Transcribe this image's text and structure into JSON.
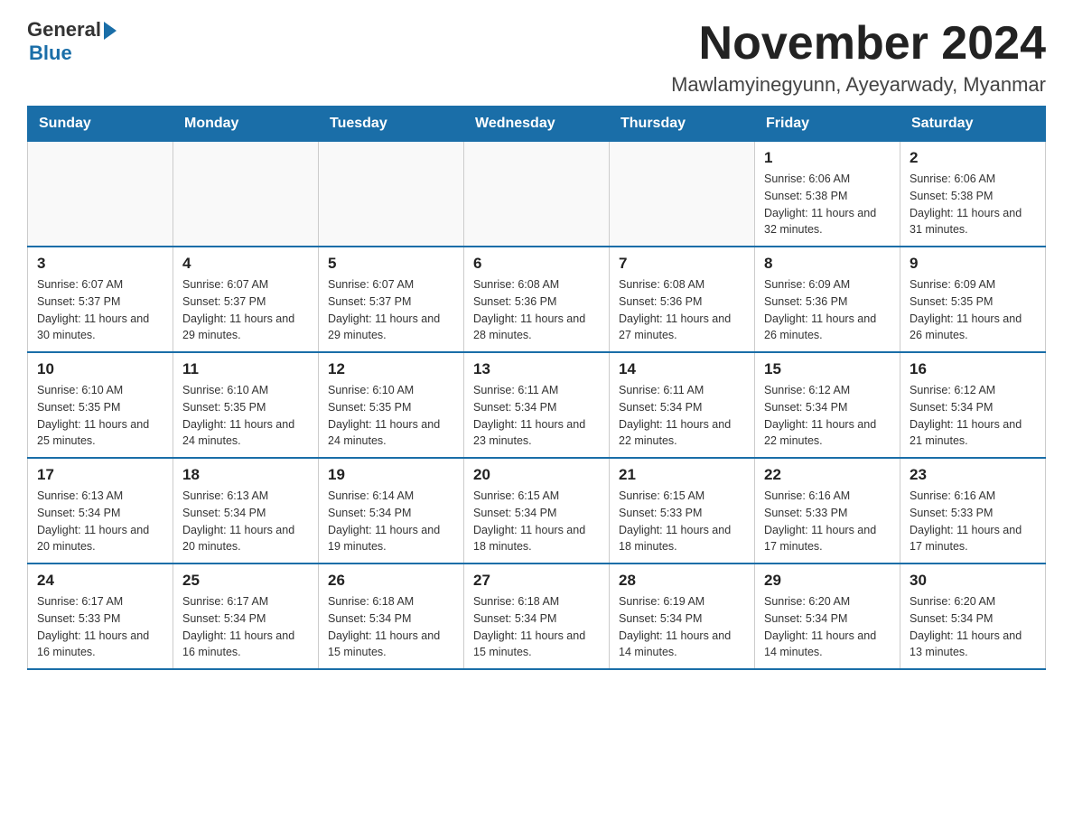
{
  "logo": {
    "text_general": "General",
    "text_blue": "Blue"
  },
  "title": "November 2024",
  "subtitle": "Mawlamyinegyunn, Ayeyarwady, Myanmar",
  "weekdays": [
    "Sunday",
    "Monday",
    "Tuesday",
    "Wednesday",
    "Thursday",
    "Friday",
    "Saturday"
  ],
  "weeks": [
    [
      {
        "day": "",
        "info": ""
      },
      {
        "day": "",
        "info": ""
      },
      {
        "day": "",
        "info": ""
      },
      {
        "day": "",
        "info": ""
      },
      {
        "day": "",
        "info": ""
      },
      {
        "day": "1",
        "info": "Sunrise: 6:06 AM\nSunset: 5:38 PM\nDaylight: 11 hours and 32 minutes."
      },
      {
        "day": "2",
        "info": "Sunrise: 6:06 AM\nSunset: 5:38 PM\nDaylight: 11 hours and 31 minutes."
      }
    ],
    [
      {
        "day": "3",
        "info": "Sunrise: 6:07 AM\nSunset: 5:37 PM\nDaylight: 11 hours and 30 minutes."
      },
      {
        "day": "4",
        "info": "Sunrise: 6:07 AM\nSunset: 5:37 PM\nDaylight: 11 hours and 29 minutes."
      },
      {
        "day": "5",
        "info": "Sunrise: 6:07 AM\nSunset: 5:37 PM\nDaylight: 11 hours and 29 minutes."
      },
      {
        "day": "6",
        "info": "Sunrise: 6:08 AM\nSunset: 5:36 PM\nDaylight: 11 hours and 28 minutes."
      },
      {
        "day": "7",
        "info": "Sunrise: 6:08 AM\nSunset: 5:36 PM\nDaylight: 11 hours and 27 minutes."
      },
      {
        "day": "8",
        "info": "Sunrise: 6:09 AM\nSunset: 5:36 PM\nDaylight: 11 hours and 26 minutes."
      },
      {
        "day": "9",
        "info": "Sunrise: 6:09 AM\nSunset: 5:35 PM\nDaylight: 11 hours and 26 minutes."
      }
    ],
    [
      {
        "day": "10",
        "info": "Sunrise: 6:10 AM\nSunset: 5:35 PM\nDaylight: 11 hours and 25 minutes."
      },
      {
        "day": "11",
        "info": "Sunrise: 6:10 AM\nSunset: 5:35 PM\nDaylight: 11 hours and 24 minutes."
      },
      {
        "day": "12",
        "info": "Sunrise: 6:10 AM\nSunset: 5:35 PM\nDaylight: 11 hours and 24 minutes."
      },
      {
        "day": "13",
        "info": "Sunrise: 6:11 AM\nSunset: 5:34 PM\nDaylight: 11 hours and 23 minutes."
      },
      {
        "day": "14",
        "info": "Sunrise: 6:11 AM\nSunset: 5:34 PM\nDaylight: 11 hours and 22 minutes."
      },
      {
        "day": "15",
        "info": "Sunrise: 6:12 AM\nSunset: 5:34 PM\nDaylight: 11 hours and 22 minutes."
      },
      {
        "day": "16",
        "info": "Sunrise: 6:12 AM\nSunset: 5:34 PM\nDaylight: 11 hours and 21 minutes."
      }
    ],
    [
      {
        "day": "17",
        "info": "Sunrise: 6:13 AM\nSunset: 5:34 PM\nDaylight: 11 hours and 20 minutes."
      },
      {
        "day": "18",
        "info": "Sunrise: 6:13 AM\nSunset: 5:34 PM\nDaylight: 11 hours and 20 minutes."
      },
      {
        "day": "19",
        "info": "Sunrise: 6:14 AM\nSunset: 5:34 PM\nDaylight: 11 hours and 19 minutes."
      },
      {
        "day": "20",
        "info": "Sunrise: 6:15 AM\nSunset: 5:34 PM\nDaylight: 11 hours and 18 minutes."
      },
      {
        "day": "21",
        "info": "Sunrise: 6:15 AM\nSunset: 5:33 PM\nDaylight: 11 hours and 18 minutes."
      },
      {
        "day": "22",
        "info": "Sunrise: 6:16 AM\nSunset: 5:33 PM\nDaylight: 11 hours and 17 minutes."
      },
      {
        "day": "23",
        "info": "Sunrise: 6:16 AM\nSunset: 5:33 PM\nDaylight: 11 hours and 17 minutes."
      }
    ],
    [
      {
        "day": "24",
        "info": "Sunrise: 6:17 AM\nSunset: 5:33 PM\nDaylight: 11 hours and 16 minutes."
      },
      {
        "day": "25",
        "info": "Sunrise: 6:17 AM\nSunset: 5:34 PM\nDaylight: 11 hours and 16 minutes."
      },
      {
        "day": "26",
        "info": "Sunrise: 6:18 AM\nSunset: 5:34 PM\nDaylight: 11 hours and 15 minutes."
      },
      {
        "day": "27",
        "info": "Sunrise: 6:18 AM\nSunset: 5:34 PM\nDaylight: 11 hours and 15 minutes."
      },
      {
        "day": "28",
        "info": "Sunrise: 6:19 AM\nSunset: 5:34 PM\nDaylight: 11 hours and 14 minutes."
      },
      {
        "day": "29",
        "info": "Sunrise: 6:20 AM\nSunset: 5:34 PM\nDaylight: 11 hours and 14 minutes."
      },
      {
        "day": "30",
        "info": "Sunrise: 6:20 AM\nSunset: 5:34 PM\nDaylight: 11 hours and 13 minutes."
      }
    ]
  ]
}
